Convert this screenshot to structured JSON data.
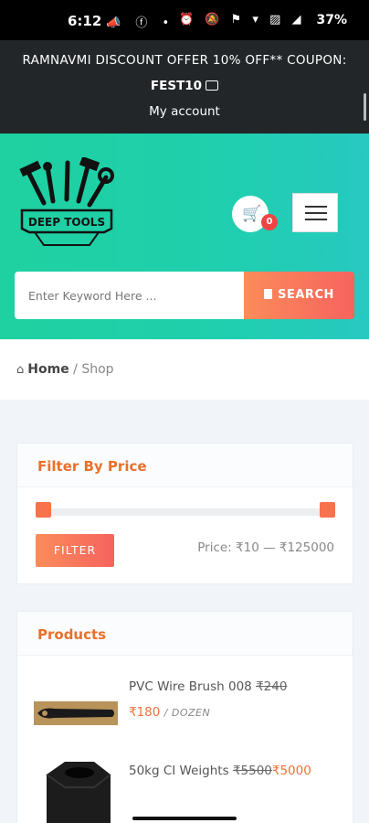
{
  "status_bar": {
    "time": "6:12",
    "notif_icons": "📣 ⓕ •",
    "system_icons": "⏰ 🔕 ⚑ ▾ ▨ ◢",
    "battery": "37%"
  },
  "announcement": {
    "offer": "RAMNAVMI DISCOUNT OFFER 10% OFF** COUPON:",
    "coupon_code": "FEST10",
    "my_account": "My account"
  },
  "header": {
    "logo_text": "DEEP TOOLS",
    "cart_count": "0",
    "search_placeholder": "Enter Keyword Here ...",
    "search_button": "SEARCH"
  },
  "breadcrumb": {
    "home": "Home",
    "separator": " / ",
    "current": "Shop"
  },
  "filter_by_price": {
    "title": "Filter By Price",
    "button": "FILTER",
    "price_label": "Price: ₹10 — ₹125000",
    "range_min": 10,
    "range_max": 125000,
    "selected_min": 10,
    "selected_max": 125000
  },
  "products": {
    "title": "Products",
    "items": [
      {
        "name": "PVC Wire Brush 008",
        "old_price": "₹240",
        "price": "₹180",
        "unit": "/ DOZEN"
      },
      {
        "name": "50kg CI Weights",
        "old_price": "₹5500",
        "price": "₹5000"
      }
    ]
  },
  "colors": {
    "header_gradient_start": "#1fd0a0",
    "accent_orange": "#f6635e",
    "title_orange": "#e8702a",
    "badge_red": "#ef4444"
  }
}
